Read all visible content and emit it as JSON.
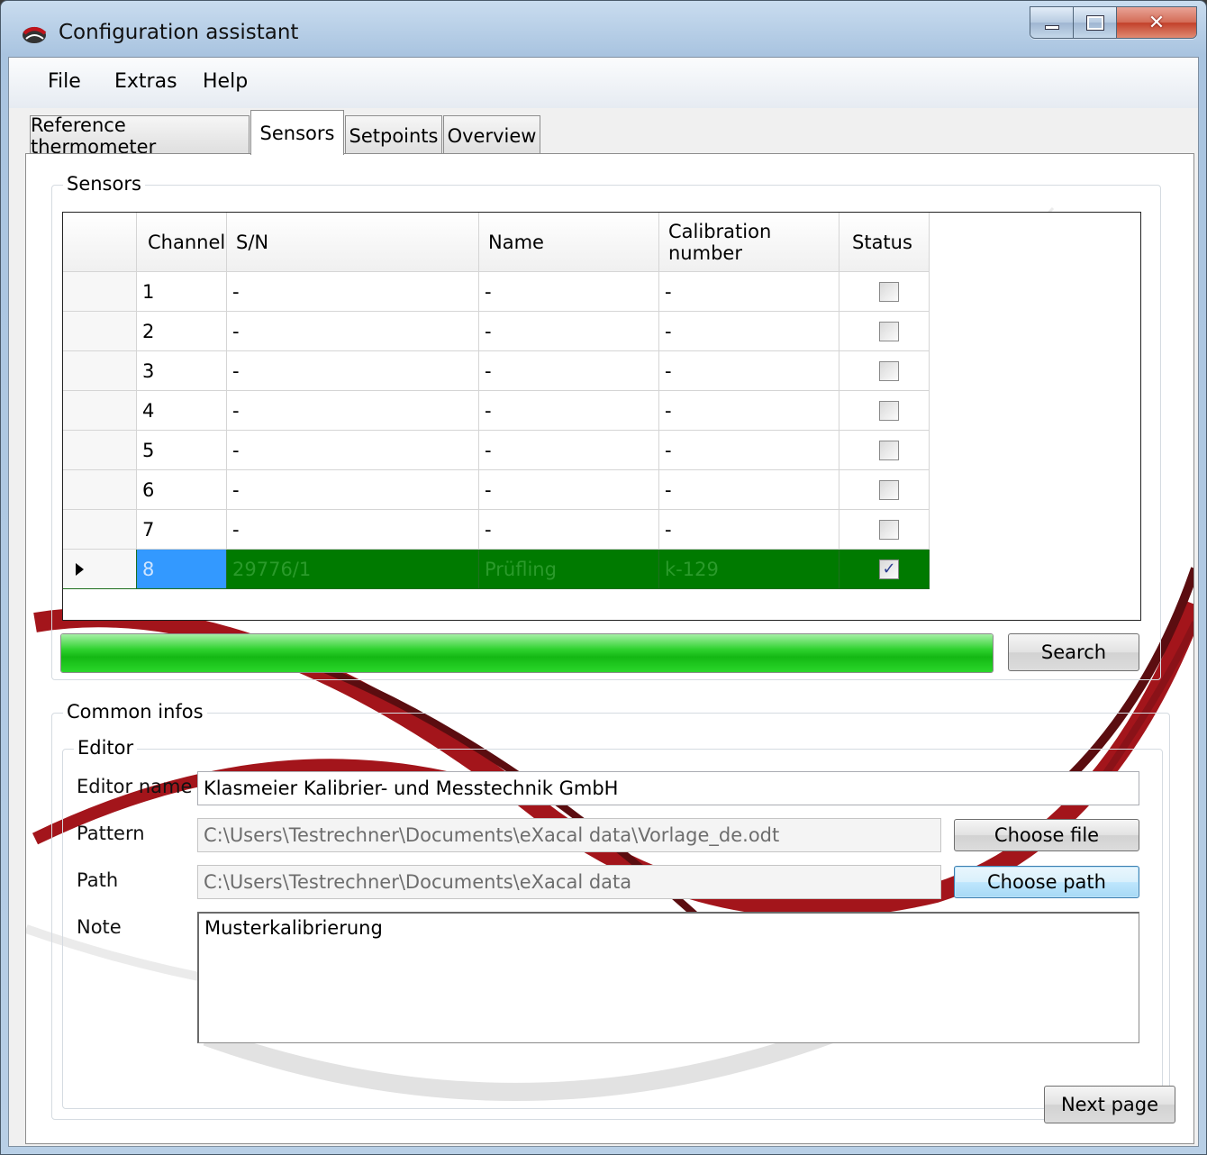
{
  "window": {
    "title": "Configuration assistant"
  },
  "menu": {
    "items": [
      "File",
      "Extras",
      "Help"
    ]
  },
  "tabs": [
    "Reference thermometer",
    "Sensors",
    "Setpoints",
    "Overview"
  ],
  "sensors_group": {
    "legend": "Sensors",
    "columns": [
      "Channel",
      "S/N",
      "Name",
      "Calibration number",
      "Status"
    ],
    "rows": [
      {
        "channel": "1",
        "sn": "-",
        "name": "-",
        "calib": "-",
        "status": false
      },
      {
        "channel": "2",
        "sn": "-",
        "name": "-",
        "calib": "-",
        "status": false
      },
      {
        "channel": "3",
        "sn": "-",
        "name": "-",
        "calib": "-",
        "status": false
      },
      {
        "channel": "4",
        "sn": "-",
        "name": "-",
        "calib": "-",
        "status": false
      },
      {
        "channel": "5",
        "sn": "-",
        "name": "-",
        "calib": "-",
        "status": false
      },
      {
        "channel": "6",
        "sn": "-",
        "name": "-",
        "calib": "-",
        "status": false
      },
      {
        "channel": "7",
        "sn": "-",
        "name": "-",
        "calib": "-",
        "status": false
      },
      {
        "channel": "8",
        "sn": "29776/1",
        "name": "Prüfling",
        "calib": "k-129",
        "status": true
      }
    ],
    "progress": 1.0,
    "search_label": "Search"
  },
  "common": {
    "legend": "Common infos",
    "editor_legend": "Editor",
    "editor_name_label": "Editor name",
    "editor_name_value": "Klasmeier Kalibrier- und Messtechnik GmbH",
    "pattern_label": "Pattern",
    "pattern_value": "C:\\Users\\Testrechner\\Documents\\eXacal data\\Vorlage_de.odt",
    "choose_file_label": "Choose file",
    "path_label": "Path",
    "path_value": "C:\\Users\\Testrechner\\Documents\\eXacal data",
    "choose_path_label": "Choose path",
    "note_label": "Note",
    "note_value": "Musterkalibrierung"
  },
  "next_page_label": "Next page",
  "colors": {
    "selected_row": "#007a00",
    "selected_cell": "#3399ff",
    "progress": "#14b814"
  }
}
